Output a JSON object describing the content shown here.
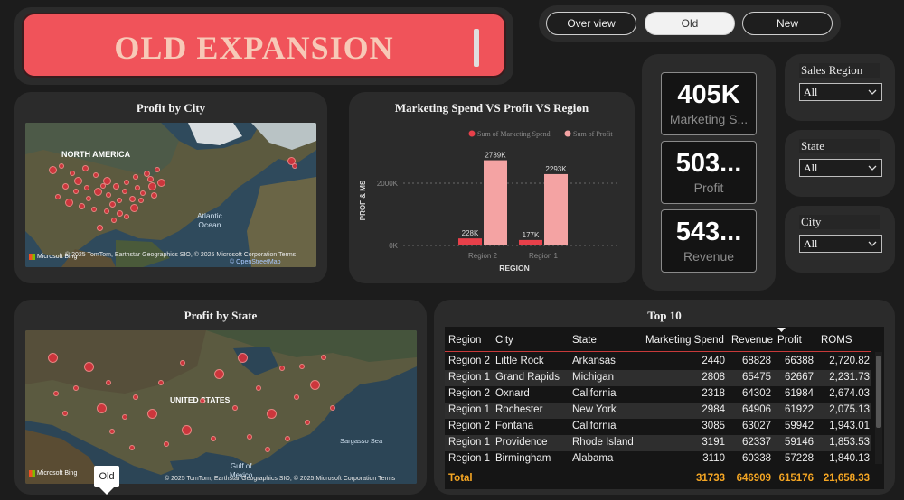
{
  "title": "OLD EXPANSION",
  "nav": {
    "buttons": [
      "Over view",
      "Old",
      "New"
    ],
    "active": "Old"
  },
  "profit_by_city": {
    "title": "Profit by City",
    "labels": {
      "continent": "NORTH AMERICA",
      "ocean": "Atlantic\nOcean",
      "ocean_line1": "Atlantic",
      "ocean_line2": "Ocean"
    },
    "credit": "© 2025 TomTom, Earthstar Geographics SIO, © 2025 Microsoft Corporation  Terms",
    "credit2": "© OpenStreetMap",
    "bing": "Microsoft Bing"
  },
  "marketing_chart": {
    "title": "Marketing Spend VS Profit VS Region"
  },
  "chart_data": {
    "type": "bar",
    "title": "Marketing Spend VS Profit VS Region",
    "xlabel": "REGION",
    "ylabel": "PROF & MS",
    "categories": [
      "Region 2",
      "Region 1"
    ],
    "series": [
      {
        "name": "Sum of Marketing Spend",
        "values": [
          228,
          177
        ],
        "labels": [
          "228K",
          "177K"
        ],
        "color": "#e8404a"
      },
      {
        "name": "Sum of Profit",
        "values": [
          2739,
          2293
        ],
        "labels": [
          "2739K",
          "2293K"
        ],
        "color": "#f4a3a3"
      }
    ],
    "yticks": [
      "0K",
      "2000K"
    ],
    "ytick_values": [
      0,
      2000
    ],
    "ylim": [
      0,
      2900
    ],
    "legend": "top-right",
    "grid": true
  },
  "kpis": [
    {
      "value": "405K",
      "label": "Marketing S..."
    },
    {
      "value": "503...",
      "label": "Profit"
    },
    {
      "value": "543...",
      "label": "Revenue"
    }
  ],
  "slicers": [
    {
      "title": "Sales Region",
      "value": "All"
    },
    {
      "title": "State",
      "value": "All"
    },
    {
      "title": "City",
      "value": "All"
    }
  ],
  "profit_by_state": {
    "title": "Profit by State",
    "labels": {
      "country": "UNITED STATES",
      "gulf1": "Gulf of",
      "gulf2": "Mexico",
      "sargasso": "Sargasso Sea"
    },
    "credit": "© 2025 TomTom, Earthstar Geographics SIO, © 2025 Microsoft Corporation  Terms",
    "bing": "Microsoft Bing"
  },
  "top10": {
    "title": "Top 10",
    "columns": [
      "Region",
      "City",
      "State",
      "Marketing Spend",
      "Revenue",
      "Profit",
      "ROMS"
    ],
    "rows": [
      [
        "Region 2",
        "Little Rock",
        "Arkansas",
        "2440",
        "68828",
        "66388",
        "2,720.82"
      ],
      [
        "Region 1",
        "Grand Rapids",
        "Michigan",
        "2808",
        "65475",
        "62667",
        "2,231.73"
      ],
      [
        "Region 2",
        "Oxnard",
        "California",
        "2318",
        "64302",
        "61984",
        "2,674.03"
      ],
      [
        "Region 1",
        "Rochester",
        "New York",
        "2984",
        "64906",
        "61922",
        "2,075.13"
      ],
      [
        "Region 2",
        "Fontana",
        "California",
        "3085",
        "63027",
        "59942",
        "1,943.01"
      ],
      [
        "Region 1",
        "Providence",
        "Rhode Island",
        "3191",
        "62337",
        "59146",
        "1,853.53"
      ],
      [
        "Region 1",
        "Birmingham",
        "Alabama",
        "3110",
        "60338",
        "57228",
        "1,840.13"
      ]
    ],
    "total": [
      "Total",
      "",
      "",
      "31733",
      "646909",
      "615176",
      "21,658.33"
    ]
  },
  "tooltip": "Old",
  "colors": {
    "accent": "#f0535a",
    "title_text": "#f7c9b7",
    "total": "#f5a623",
    "dot": "#e0303c"
  }
}
